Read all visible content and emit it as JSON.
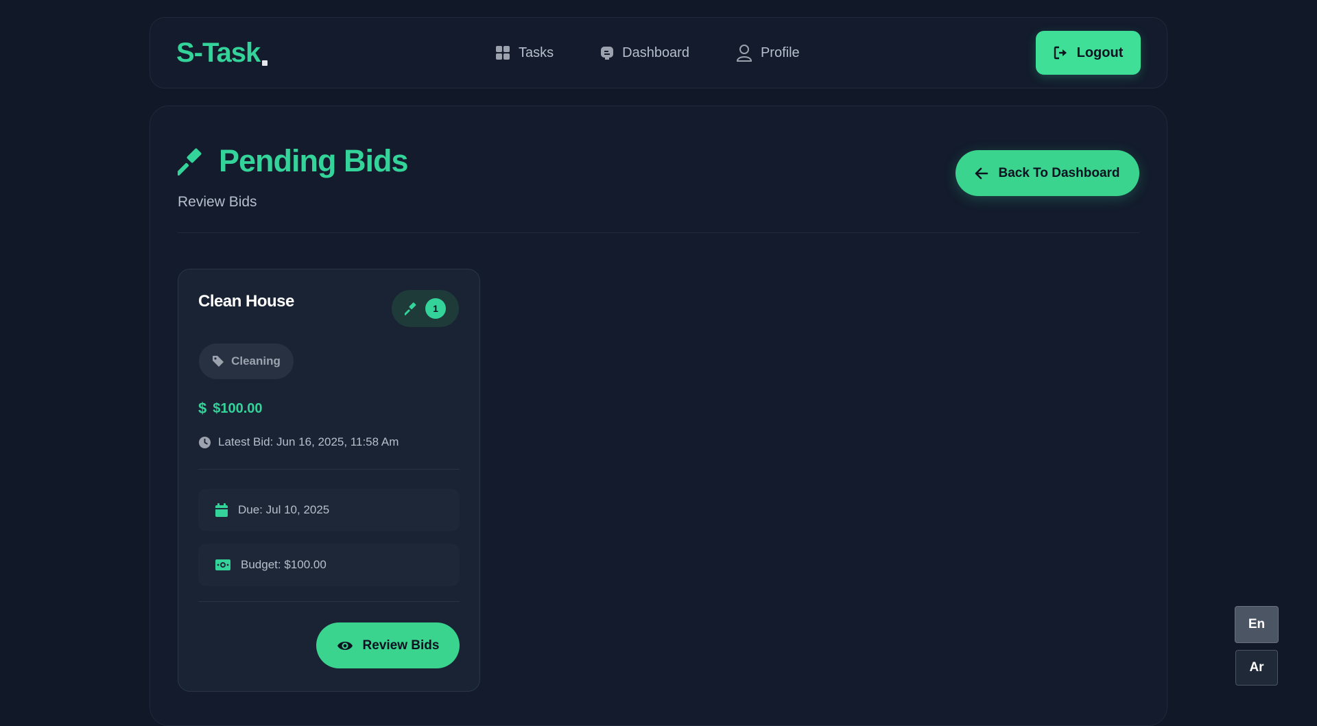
{
  "navbar": {
    "logo": "S-Task",
    "links": [
      {
        "label": "Tasks",
        "icon": "grid-icon"
      },
      {
        "label": "Dashboard",
        "icon": "dashboard-icon"
      },
      {
        "label": "Profile",
        "icon": "user-icon"
      }
    ],
    "logout_label": "Logout"
  },
  "page": {
    "title": "Pending Bids",
    "subtitle": "Review Bids",
    "back_label": "Back To Dashboard"
  },
  "task": {
    "title": "Clean House",
    "bid_count": "1",
    "category": "Cleaning",
    "price": "$100.00",
    "latest_bid": "Latest Bid: Jun 16, 2025, 11:58 Am",
    "due": "Due: Jul 10, 2025",
    "budget": "Budget: $100.00",
    "review_label": "Review Bids"
  },
  "language": {
    "options": [
      "En",
      "Ar"
    ],
    "selected": "En"
  },
  "colors": {
    "accent": "#34d399",
    "background": "#111827",
    "card": "#131b2c"
  }
}
